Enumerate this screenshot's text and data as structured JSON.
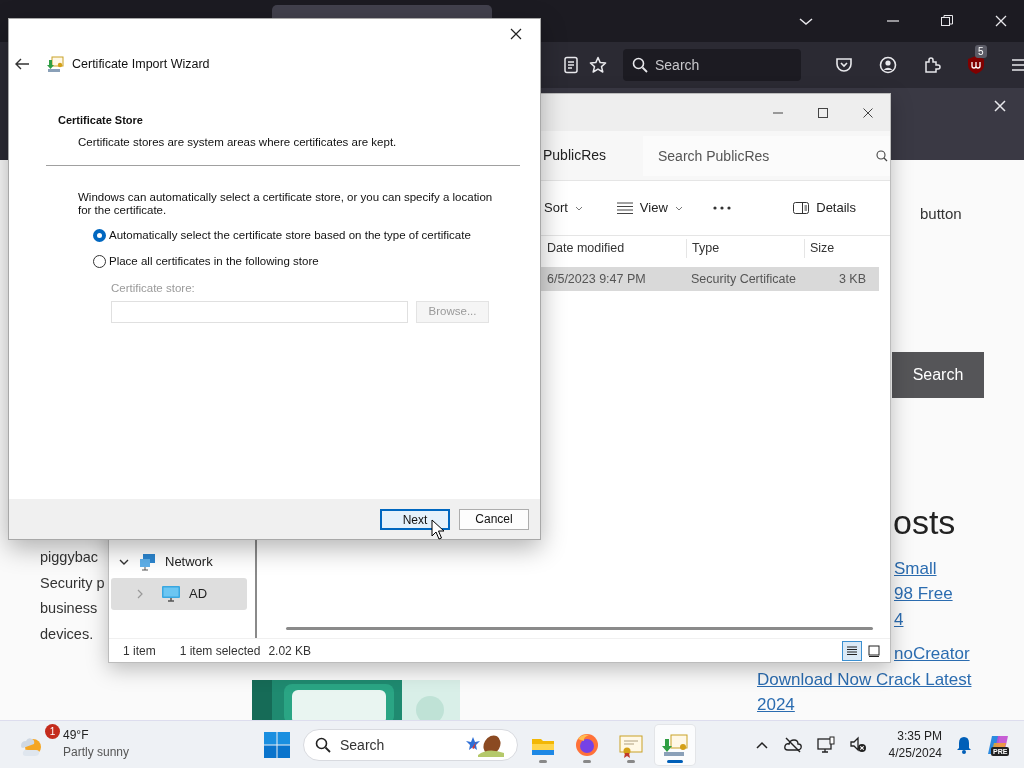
{
  "browser": {
    "search_placeholder": "Search",
    "extension_badge": "5"
  },
  "web_page": {
    "article_lines": [
      "piggybac",
      "Security p",
      "business",
      "devices."
    ],
    "sidebar_text": "button",
    "search_button": "Search",
    "heading": "osts",
    "posts": [
      {
        "lines": [
          {
            "text": "Small",
            "clipped": true
          },
          {
            "text": "98 Free",
            "clipped": true
          },
          {
            "text": "4",
            "clipped": true
          }
        ]
      },
      {
        "lines": [
          {
            "text": "noCreator",
            "clipped": true
          },
          {
            "text": "Download Now Crack Latest",
            "clipped": false
          },
          {
            "text": "2024",
            "clipped": false
          }
        ]
      }
    ]
  },
  "file_explorer": {
    "location": "PublicRes",
    "search_placeholder": "Search PublicRes",
    "toolbar": [
      {
        "kind": "dropdown",
        "label": "Sort"
      },
      {
        "kind": "view",
        "label": "View"
      },
      {
        "kind": "more"
      },
      {
        "kind": "pane",
        "label": "Details"
      }
    ],
    "columns": [
      "Date modified",
      "Type",
      "Size"
    ],
    "rows": [
      {
        "cells": [
          "6/5/2023 9:47 PM",
          "Security Certificate",
          "3 KB"
        ],
        "selected": true
      }
    ],
    "nav": [
      {
        "label": "Network",
        "kind": "network",
        "expanded": true,
        "selected": false,
        "children": [
          {
            "label": "AD",
            "kind": "computer",
            "expanded": false,
            "selected": true
          }
        ]
      }
    ],
    "status": {
      "count": "1 item",
      "selection": "1 item selected",
      "size": "2.02 KB"
    },
    "views": [
      {
        "kind": "details",
        "selected": true
      },
      {
        "kind": "tiles",
        "selected": false
      }
    ]
  },
  "dialog": {
    "title": "Certificate Import Wizard",
    "heading": "Certificate Store",
    "subheading": "Certificate stores are system areas where certificates are kept.",
    "intro": "Windows can automatically select a certificate store, or you can specify a location for the certificate.",
    "options": [
      {
        "label": "Automatically select the certificate store based on the type of certificate",
        "selected": true
      },
      {
        "label": "Place all certificates in the following store",
        "selected": false
      }
    ],
    "store_label": "Certificate store:",
    "store_disabled": true,
    "browse": "Browse...",
    "buttons": [
      {
        "label": "Next",
        "default": true
      },
      {
        "label": "Cancel",
        "default": false
      }
    ]
  },
  "taskbar": {
    "weather": {
      "badge": "1",
      "temperature": "49°F",
      "condition": "Partly sunny"
    },
    "search_placeholder": "Search",
    "apps": [
      {
        "kind": "folder",
        "active": false
      },
      {
        "kind": "firefox",
        "active": false
      },
      {
        "kind": "certificate",
        "active": false
      },
      {
        "kind": "wizard",
        "active": true
      }
    ],
    "time": "3:35 PM",
    "date": "4/25/2024",
    "copilot_badge": "PRE"
  }
}
